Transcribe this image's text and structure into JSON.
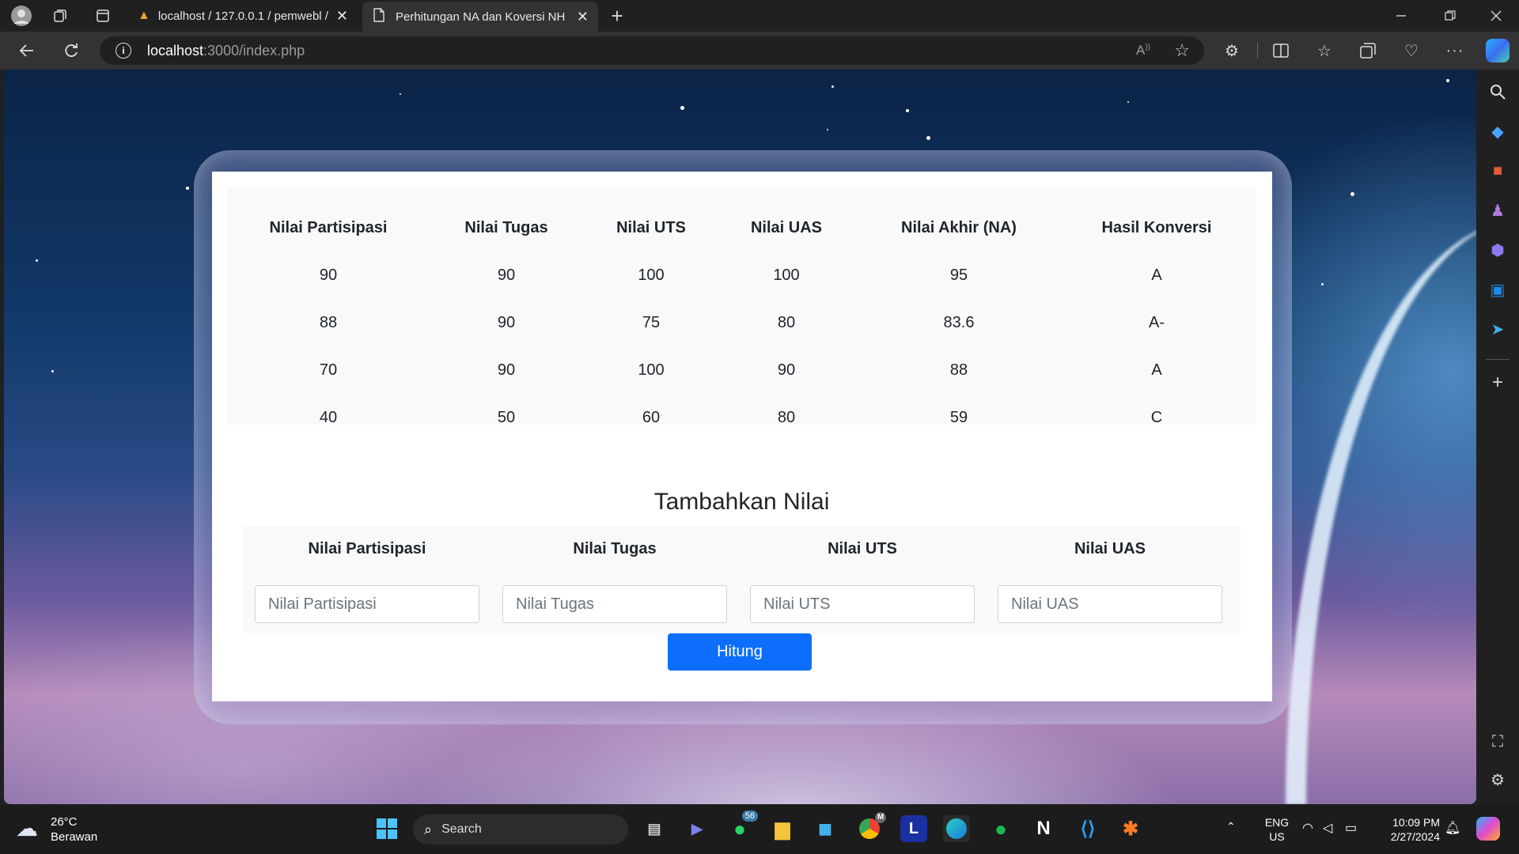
{
  "browser": {
    "tabs": [
      {
        "title": "localhost / 127.0.0.1 / pemwebl /"
      },
      {
        "title": "Perhitungan NA dan Koversi NH"
      }
    ],
    "url_host": "localhost",
    "url_path": ":3000/index.php",
    "read_aloud_icon": "read-aloud-icon"
  },
  "results": {
    "headers": [
      "Nilai Partisipasi",
      "Nilai Tugas",
      "Nilai UTS",
      "Nilai UAS",
      "Nilai Akhir (NA)",
      "Hasil Konversi"
    ],
    "rows": [
      [
        "90",
        "90",
        "100",
        "100",
        "95",
        "A"
      ],
      [
        "88",
        "90",
        "75",
        "80",
        "83.6",
        "A-"
      ],
      [
        "70",
        "90",
        "100",
        "90",
        "88",
        "A"
      ],
      [
        "40",
        "50",
        "60",
        "80",
        "59",
        "C"
      ]
    ]
  },
  "form": {
    "title": "Tambahkan Nilai",
    "fields": [
      {
        "label": "Nilai Partisipasi",
        "placeholder": "Nilai Partisipasi"
      },
      {
        "label": "Nilai Tugas",
        "placeholder": "Nilai Tugas"
      },
      {
        "label": "Nilai UTS",
        "placeholder": "Nilai UTS"
      },
      {
        "label": "Nilai UAS",
        "placeholder": "Nilai UAS"
      }
    ],
    "submit_label": "Hitung"
  },
  "taskbar": {
    "weather_temp": "26°C",
    "weather_desc": "Berawan",
    "search_label": "Search",
    "whatsapp_badge": "56",
    "chrome_badge": "M",
    "lang_top": "ENG",
    "lang_bottom": "US",
    "time": "10:09 PM",
    "date": "2/27/2024"
  },
  "colors": {
    "primary_button": "#0d6efd",
    "card_bg": "#f8f9fa",
    "chrome_dark": "#202020"
  }
}
